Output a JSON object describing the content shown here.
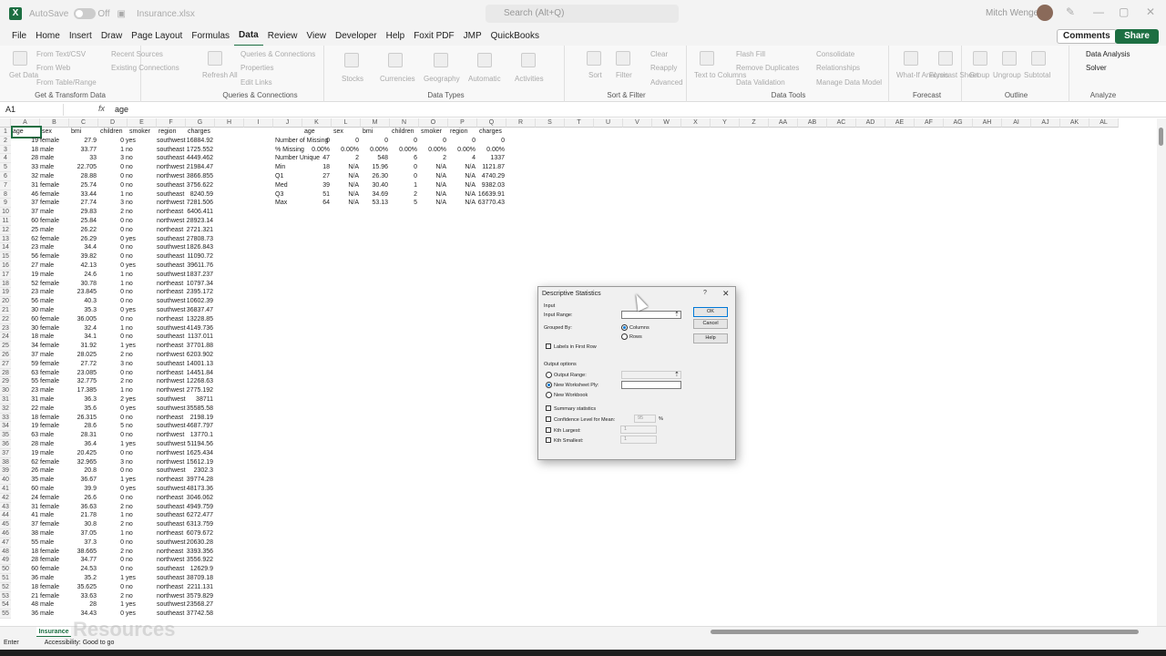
{
  "title": {
    "autosave": "AutoSave",
    "toggle": "Off",
    "filename": "Insurance.xlsx",
    "search": "Search (Alt+Q)",
    "user": "Mitch Wenger"
  },
  "menu": [
    "File",
    "Home",
    "Insert",
    "Draw",
    "Page Layout",
    "Formulas",
    "Data",
    "Review",
    "View",
    "Developer",
    "Help",
    "Foxit PDF",
    "JMP",
    "QuickBooks"
  ],
  "buttons": {
    "comments": "Comments",
    "share": "Share"
  },
  "ribbon": {
    "get_data": "Get Data",
    "from_text": "From Text/CSV",
    "from_web": "From Web",
    "from_table": "From Table/Range",
    "recent_sources": "Recent Sources",
    "existing_connections": "Existing Connections",
    "g1": "Get & Transform Data",
    "refresh": "Refresh All",
    "queries": "Queries & Connections",
    "properties": "Properties",
    "edit_links": "Edit Links",
    "g2": "Queries & Connections",
    "stocks": "Stocks",
    "currencies": "Currencies",
    "geography": "Geography",
    "automatic": "Automatic",
    "activities": "Activities",
    "g3": "Data Types",
    "sort": "Sort",
    "filter": "Filter",
    "clear": "Clear",
    "reapply": "Reapply",
    "advanced": "Advanced",
    "g4": "Sort & Filter",
    "text_to_columns": "Text to Columns",
    "flash_fill": "Flash Fill",
    "remove_duplicates": "Remove Duplicates",
    "data_validation": "Data Validation",
    "consolidate": "Consolidate",
    "relationships": "Relationships",
    "manage_model": "Manage Data Model",
    "g5": "Data Tools",
    "whatif": "What-If Analysis",
    "forecast_sheet": "Forecast Sheet",
    "g6": "Forecast",
    "group": "Group",
    "ungroup": "Ungroup",
    "subtotal": "Subtotal",
    "g7": "Outline",
    "data_analysis": "Data Analysis",
    "solver": "Solver",
    "g8": "Analyze"
  },
  "formula_bar": {
    "namebox": "A1",
    "fx": "fx",
    "content": "age"
  },
  "columns": [
    "A",
    "B",
    "C",
    "D",
    "E",
    "F",
    "G",
    "H",
    "I",
    "J",
    "K",
    "L",
    "M",
    "N",
    "O",
    "P",
    "Q",
    "R",
    "S",
    "T",
    "U",
    "V",
    "W",
    "X",
    "Y",
    "Z",
    "AA",
    "AB",
    "AC",
    "AD",
    "AE",
    "AF",
    "AG",
    "AH",
    "AI",
    "AJ",
    "AK",
    "AL"
  ],
  "data_headers": [
    "age",
    "sex",
    "bmi",
    "children",
    "smoker",
    "region",
    "charges"
  ],
  "data_rows": [
    [
      "19",
      "female",
      "27.9",
      "0",
      "yes",
      "southwest",
      "16884.92"
    ],
    [
      "18",
      "male",
      "33.77",
      "1",
      "no",
      "southeast",
      "1725.552"
    ],
    [
      "28",
      "male",
      "33",
      "3",
      "no",
      "southeast",
      "4449.462"
    ],
    [
      "33",
      "male",
      "22.705",
      "0",
      "no",
      "northwest",
      "21984.47"
    ],
    [
      "32",
      "male",
      "28.88",
      "0",
      "no",
      "northwest",
      "3866.855"
    ],
    [
      "31",
      "female",
      "25.74",
      "0",
      "no",
      "southeast",
      "3756.622"
    ],
    [
      "46",
      "female",
      "33.44",
      "1",
      "no",
      "southeast",
      "8240.59"
    ],
    [
      "37",
      "female",
      "27.74",
      "3",
      "no",
      "northwest",
      "7281.506"
    ],
    [
      "37",
      "male",
      "29.83",
      "2",
      "no",
      "northeast",
      "6406.411"
    ],
    [
      "60",
      "female",
      "25.84",
      "0",
      "no",
      "northwest",
      "28923.14"
    ],
    [
      "25",
      "male",
      "26.22",
      "0",
      "no",
      "northeast",
      "2721.321"
    ],
    [
      "62",
      "female",
      "26.29",
      "0",
      "yes",
      "southeast",
      "27808.73"
    ],
    [
      "23",
      "male",
      "34.4",
      "0",
      "no",
      "southwest",
      "1826.843"
    ],
    [
      "56",
      "female",
      "39.82",
      "0",
      "no",
      "southeast",
      "11090.72"
    ],
    [
      "27",
      "male",
      "42.13",
      "0",
      "yes",
      "southeast",
      "39611.76"
    ],
    [
      "19",
      "male",
      "24.6",
      "1",
      "no",
      "southwest",
      "1837.237"
    ],
    [
      "52",
      "female",
      "30.78",
      "1",
      "no",
      "northeast",
      "10797.34"
    ],
    [
      "23",
      "male",
      "23.845",
      "0",
      "no",
      "northeast",
      "2395.172"
    ],
    [
      "56",
      "male",
      "40.3",
      "0",
      "no",
      "southwest",
      "10602.39"
    ],
    [
      "30",
      "male",
      "35.3",
      "0",
      "yes",
      "southwest",
      "36837.47"
    ],
    [
      "60",
      "female",
      "36.005",
      "0",
      "no",
      "northeast",
      "13228.85"
    ],
    [
      "30",
      "female",
      "32.4",
      "1",
      "no",
      "southwest",
      "4149.736"
    ],
    [
      "18",
      "male",
      "34.1",
      "0",
      "no",
      "southeast",
      "1137.011"
    ],
    [
      "34",
      "female",
      "31.92",
      "1",
      "yes",
      "northeast",
      "37701.88"
    ],
    [
      "37",
      "male",
      "28.025",
      "2",
      "no",
      "northwest",
      "6203.902"
    ],
    [
      "59",
      "female",
      "27.72",
      "3",
      "no",
      "southeast",
      "14001.13"
    ],
    [
      "63",
      "female",
      "23.085",
      "0",
      "no",
      "northeast",
      "14451.84"
    ],
    [
      "55",
      "female",
      "32.775",
      "2",
      "no",
      "northwest",
      "12268.63"
    ],
    [
      "23",
      "male",
      "17.385",
      "1",
      "no",
      "northwest",
      "2775.192"
    ],
    [
      "31",
      "male",
      "36.3",
      "2",
      "yes",
      "southwest",
      "38711"
    ],
    [
      "22",
      "male",
      "35.6",
      "0",
      "yes",
      "southwest",
      "35585.58"
    ],
    [
      "18",
      "female",
      "26.315",
      "0",
      "no",
      "northeast",
      "2198.19"
    ],
    [
      "19",
      "female",
      "28.6",
      "5",
      "no",
      "southwest",
      "4687.797"
    ],
    [
      "63",
      "male",
      "28.31",
      "0",
      "no",
      "northwest",
      "13770.1"
    ],
    [
      "28",
      "male",
      "36.4",
      "1",
      "yes",
      "southwest",
      "51194.56"
    ],
    [
      "19",
      "male",
      "20.425",
      "0",
      "no",
      "northwest",
      "1625.434"
    ],
    [
      "62",
      "female",
      "32.965",
      "3",
      "no",
      "northwest",
      "15612.19"
    ],
    [
      "26",
      "male",
      "20.8",
      "0",
      "no",
      "southwest",
      "2302.3"
    ],
    [
      "35",
      "male",
      "36.67",
      "1",
      "yes",
      "northeast",
      "39774.28"
    ],
    [
      "60",
      "male",
      "39.9",
      "0",
      "yes",
      "southwest",
      "48173.36"
    ],
    [
      "24",
      "female",
      "26.6",
      "0",
      "no",
      "northeast",
      "3046.062"
    ],
    [
      "31",
      "female",
      "36.63",
      "2",
      "no",
      "southeast",
      "4949.759"
    ],
    [
      "41",
      "male",
      "21.78",
      "1",
      "no",
      "southeast",
      "6272.477"
    ],
    [
      "37",
      "female",
      "30.8",
      "2",
      "no",
      "southeast",
      "6313.759"
    ],
    [
      "38",
      "male",
      "37.05",
      "1",
      "no",
      "northeast",
      "6079.672"
    ],
    [
      "55",
      "male",
      "37.3",
      "0",
      "no",
      "southwest",
      "20630.28"
    ],
    [
      "18",
      "female",
      "38.665",
      "2",
      "no",
      "northeast",
      "3393.356"
    ],
    [
      "28",
      "female",
      "34.77",
      "0",
      "no",
      "northwest",
      "3556.922"
    ],
    [
      "60",
      "female",
      "24.53",
      "0",
      "no",
      "southeast",
      "12629.9"
    ],
    [
      "36",
      "male",
      "35.2",
      "1",
      "yes",
      "southeast",
      "38709.18"
    ],
    [
      "18",
      "female",
      "35.625",
      "0",
      "no",
      "northeast",
      "2211.131"
    ],
    [
      "21",
      "female",
      "33.63",
      "2",
      "no",
      "northwest",
      "3579.829"
    ],
    [
      "48",
      "male",
      "28",
      "1",
      "yes",
      "southwest",
      "23568.27"
    ],
    [
      "36",
      "male",
      "34.43",
      "0",
      "yes",
      "southeast",
      "37742.58"
    ]
  ],
  "stats": {
    "headers": [
      "age",
      "sex",
      "bmi",
      "children",
      "smoker",
      "region",
      "charges"
    ],
    "rows": [
      {
        "label": "Number of Missing",
        "values": [
          "0",
          "0",
          "0",
          "0",
          "0",
          "0",
          "0"
        ]
      },
      {
        "label": "% Missing",
        "values": [
          "0.00%",
          "0.00%",
          "0.00%",
          "0.00%",
          "0.00%",
          "0.00%",
          "0.00%"
        ]
      },
      {
        "label": "Number Unique",
        "values": [
          "47",
          "2",
          "548",
          "6",
          "2",
          "4",
          "1337"
        ]
      },
      {
        "label": "Min",
        "values": [
          "18",
          "N/A",
          "15.96",
          "0",
          "N/A",
          "N/A",
          "1121.87"
        ]
      },
      {
        "label": "Q1",
        "values": [
          "27",
          "N/A",
          "26.30",
          "0",
          "N/A",
          "N/A",
          "4740.29"
        ]
      },
      {
        "label": "Med",
        "values": [
          "39",
          "N/A",
          "30.40",
          "1",
          "N/A",
          "N/A",
          "9382.03"
        ]
      },
      {
        "label": "Q3",
        "values": [
          "51",
          "N/A",
          "34.69",
          "2",
          "N/A",
          "N/A",
          "16639.91"
        ]
      },
      {
        "label": "Max",
        "values": [
          "64",
          "N/A",
          "53.13",
          "5",
          "N/A",
          "N/A",
          "63770.43"
        ]
      }
    ]
  },
  "sheet_tab": "Insurance",
  "status": {
    "mode": "Enter",
    "accessibility": "Accessibility: Good to go"
  },
  "dialog": {
    "title": "Descriptive Statistics",
    "help_glyph": "?",
    "close_glyph": "✕",
    "input_section": "Input",
    "input_range": "Input Range:",
    "grouped_by": "Grouped By:",
    "columns": "Columns",
    "rows": "Rows",
    "labels_first_row": "Labels in First Row",
    "output_options": "Output options",
    "output_range": "Output Range:",
    "new_ply": "New Worksheet Ply:",
    "new_workbook": "New Workbook",
    "summary_stats": "Summary statistics",
    "confidence": "Confidence Level for Mean:",
    "confidence_value": "95",
    "percent": "%",
    "kth_largest": "Kth Largest:",
    "kth_largest_value": "1",
    "kth_smallest": "Kth Smallest:",
    "kth_smallest_value": "1",
    "ok": "OK",
    "cancel": "Cancel",
    "help": "Help"
  },
  "watermark": "Resources"
}
